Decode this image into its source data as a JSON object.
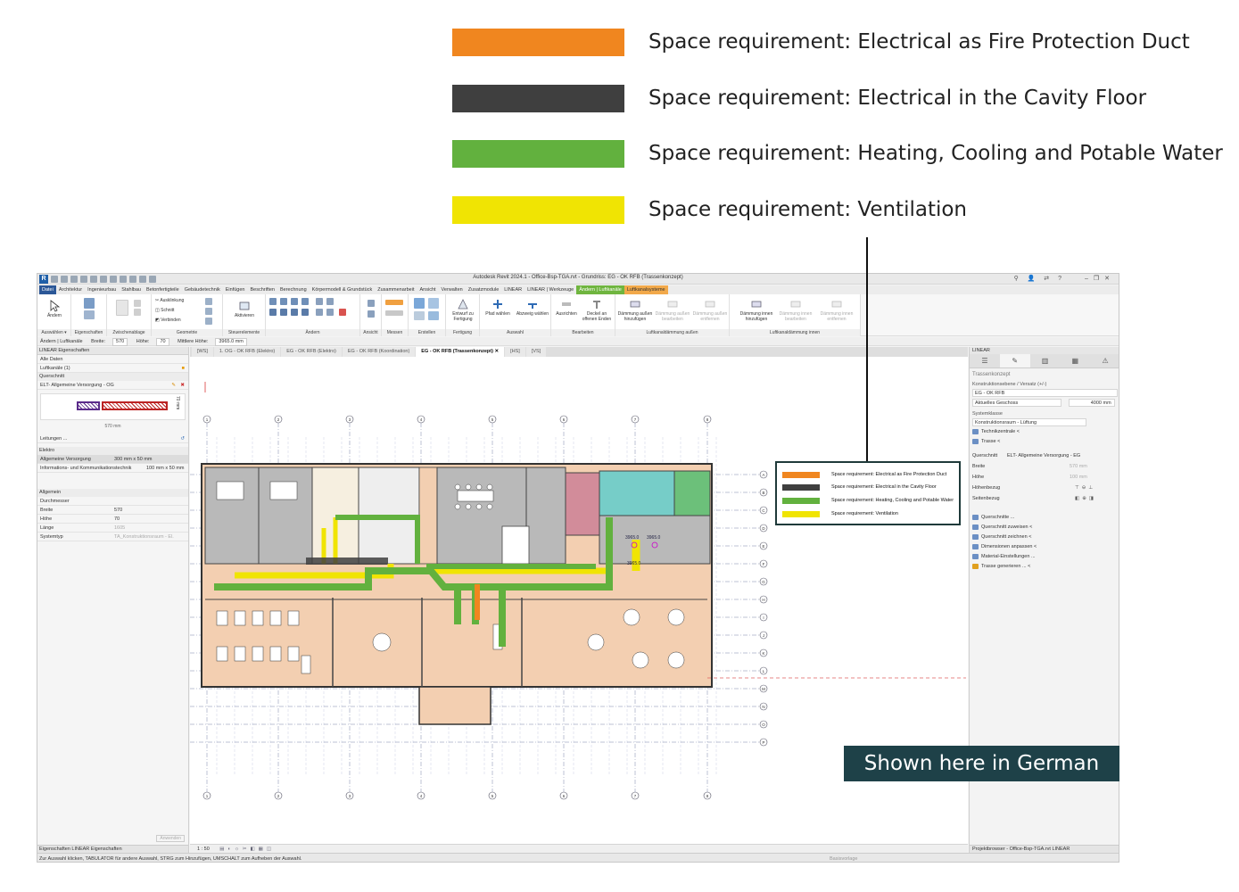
{
  "legend": {
    "items": [
      {
        "label": "Space requirement: Electrical as Fire Protection Duct",
        "color": "#f0861f"
      },
      {
        "label": "Space requirement: Electrical in the Cavity Floor",
        "color": "#3f3f3f"
      },
      {
        "label": "Space requirement: Heating, Cooling and Potable Water",
        "color": "#62b13e"
      },
      {
        "label": "Space requirement: Ventilation",
        "color": "#f0e403"
      }
    ]
  },
  "banner": {
    "text": "Shown here in German"
  },
  "app": {
    "title": "Autodesk Revit 2024.1 - Office-Bsp-TGA.rvt - Grundriss: EG - OK RFB (Trassenkonzept)",
    "logo": "R"
  },
  "menu": [
    {
      "label": "Datei",
      "state": "active"
    },
    {
      "label": "Architektur"
    },
    {
      "label": "Ingenieurbau"
    },
    {
      "label": "Stahlbau"
    },
    {
      "label": "Betonfertigteile"
    },
    {
      "label": "Gebäudetechnik"
    },
    {
      "label": "Einfügen"
    },
    {
      "label": "Beschriften"
    },
    {
      "label": "Berechnung"
    },
    {
      "label": "Körpermodell & Grundstück"
    },
    {
      "label": "Zusammenarbeit"
    },
    {
      "label": "Ansicht"
    },
    {
      "label": "Verwalten"
    },
    {
      "label": "Zusatzmodule"
    },
    {
      "label": "LINEAR"
    },
    {
      "label": "LINEAR | Werkzeuge"
    },
    {
      "label": "Ändern | Luftkanäle",
      "state": "ctx1"
    },
    {
      "label": "Luftkanalsysteme",
      "state": "ctx2"
    }
  ],
  "ribbon": {
    "groups": {
      "select": "Auswählen ▾",
      "properties": "Eigenschaften",
      "clipboard": "Zwischenablage",
      "geometry": "Geometrie",
      "controls": "Steuerelemente",
      "modify": "Ändern",
      "view": "Ansicht",
      "measure": "Messen",
      "create": "Erstellen",
      "fabrication": "Fertigung",
      "selection": "Auswahl",
      "edit": "Bearbeiten",
      "insulation": "Luftkanaldämmung außen",
      "insulation_inner": "Luftkanaldämmung innen"
    },
    "tools": {
      "modify": "Ändern",
      "join1": "Ausklinkung",
      "cut": "Schnitt",
      "join": "Verbinden",
      "activate": "Aktivieren",
      "design_fab": "Entwurf zu Fertigung",
      "select_path": "Pfad wählen",
      "select_branch": "Abzweig wählen",
      "align": "Ausrichten",
      "cap_open": "Deckel an offenen Enden",
      "add_ins": "Dämmung außen hinzufügen",
      "edit_ins": "Dämmung außen bearbeiten",
      "remove_ins": "Dämmung außen entfernen",
      "add_inner": "Dämmung innen hinzufügen",
      "edit_inner": "Dämmung innen bearbeiten",
      "remove_inner": "Dämmung innen entfernen"
    }
  },
  "optionsbar": {
    "context": "Ändern | Luftkanäle",
    "width_label": "Breite:",
    "width_value": "570",
    "height_label": "Höhe:",
    "height_value": "70",
    "mid_label": "Mittlere Höhe:",
    "mid_value": "3965.0 mm"
  },
  "left_panel": {
    "title": "LINEAR Eigenschaften",
    "filter": "Alle Daten",
    "category": "Luftkanäle (1)",
    "section_title": "Querschnitt",
    "family": "ELT- Allgemeine Versorgung - OG",
    "preview_width": "570 mm",
    "preview_height": "70 mm",
    "lines_label": "Leitungen ...",
    "elektro_title": "Elektro",
    "elektro_rows": [
      {
        "k": "Allgemeine Versorgung",
        "v": "300 mm x 50 mm"
      },
      {
        "k": "Informations- und Kommunikationstechnik",
        "v": "100 mm x 50 mm"
      }
    ],
    "general_title": "Allgemein",
    "general_rows": [
      {
        "k": "Durchmesser",
        "v": ""
      },
      {
        "k": "Breite",
        "v": "570"
      },
      {
        "k": "Höhe",
        "v": "70"
      },
      {
        "k": "Länge",
        "v": "1605"
      },
      {
        "k": "Systemtyp",
        "v": "TA_Konstruktionsraum - El."
      }
    ],
    "apply": "Anwenden",
    "tabs": "Eigenschaften   LINEAR Eigenschaften"
  },
  "view_tabs": [
    {
      "label": "[WS]"
    },
    {
      "label": "1. OG - OK RFB (Elektro)"
    },
    {
      "label": "EG - OK RFB (Elektro)"
    },
    {
      "label": "EG - OK RFB (Koordination)"
    },
    {
      "label": "EG - OK RFB (Trassenkonzept)  ✕",
      "active": true
    },
    {
      "label": "[HS]"
    },
    {
      "label": "[VS]"
    }
  ],
  "right_panel": {
    "title": "LINEAR",
    "heading": "Trassenkonzept",
    "level_label": "Konstruktionsebene / Versatz (+/-)",
    "level_value": "EG - OK RFB",
    "current_level": "Aktuelles Geschoss",
    "offset": "4000 mm",
    "system_class": "Systemklasse",
    "system_value": "Konstruktionsraum - Lüftung",
    "central": "Technikzentrale <",
    "route": "Trasse <",
    "section_label": "Querschnitt",
    "section_value": "ELT- Allgemeine Versorgung - EG",
    "rows": [
      {
        "k": "Breite",
        "v": "570 mm"
      },
      {
        "k": "Höhe",
        "v": "100 mm"
      },
      {
        "k": "Höhenbezug",
        "v": ""
      },
      {
        "k": "Seitenbezug",
        "v": ""
      }
    ],
    "links": [
      "Querschnitte ...",
      "Querschnitt zuweisen <",
      "Querschnitt zeichnen <",
      "Dimensionen anpassen <",
      "Material-Einstellungen ...",
      "Trasse generieren ... <"
    ],
    "bottom": "Projektbrowser - Office-Bsp-TGA.rvt   LINEAR"
  },
  "canvas": {
    "dims": [
      "3965.0",
      "3965.0",
      "3965.0"
    ],
    "grid_cols": [
      "1",
      "2",
      "3",
      "4",
      "5",
      "6",
      "7",
      "8"
    ],
    "grid_rows": [
      "A",
      "B",
      "C",
      "D",
      "E",
      "F",
      "G",
      "H",
      "I",
      "J",
      "K",
      "L",
      "M",
      "N",
      "O",
      "P"
    ]
  },
  "viewbar": {
    "scale": "1 : 50"
  },
  "status": {
    "text": "Zur Auswahl klicken, TABULATOR für andere Auswahl, STRG zum Hinzufügen, UMSCHALT zum Aufheben der Auswahl.",
    "right": "Basisvorlage"
  },
  "colors": {
    "orange": "#f0861f",
    "dark": "#3f3f3f",
    "green": "#62b13e",
    "yellow": "#f0e403",
    "floor": "#f1c9a8",
    "banner": "#1e4148"
  }
}
